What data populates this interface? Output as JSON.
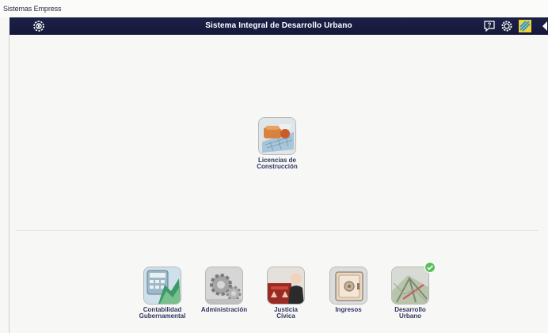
{
  "window": {
    "title": "Sistemas Empress"
  },
  "header": {
    "title": "Sistema Integral de Desarrollo Urbano",
    "menu_icon": "tools-icon",
    "help_icon": "help-icon",
    "settings_icon": "gear-icon",
    "extra_icon": "puzzle-icon",
    "accent": "#1b1f45"
  },
  "featured_app": {
    "line1": "Licencias de",
    "line2": "Construcción",
    "icon": "blueprint-icon"
  },
  "modules": [
    {
      "line1": "Contabilidad",
      "line2": "Gubernamental",
      "icon": "calculator-icon"
    },
    {
      "line1": "Administración",
      "line2": "",
      "icon": "gears-icon"
    },
    {
      "line1": "Justicia",
      "line2": "Cívica",
      "icon": "justice-icon"
    },
    {
      "line1": "Ingresos",
      "line2": "",
      "icon": "safe-icon"
    },
    {
      "line1": "Desarrollo",
      "line2": "Urbano",
      "icon": "map-icon",
      "active": true
    }
  ]
}
